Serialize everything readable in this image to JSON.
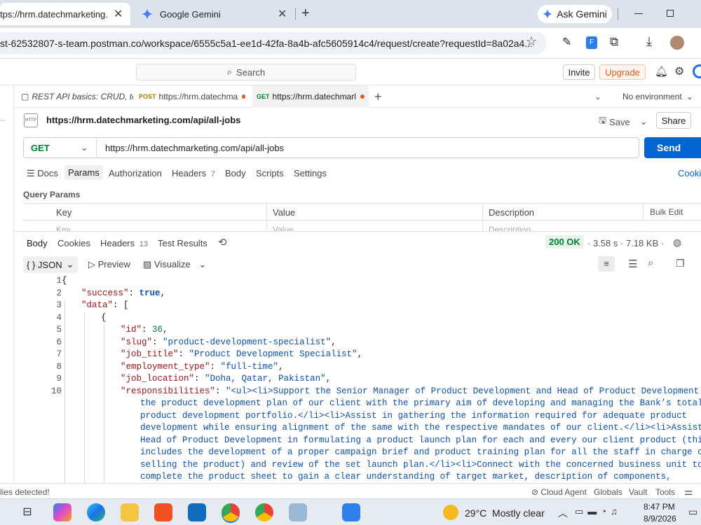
{
  "browser": {
    "tabs": [
      {
        "title": "tps://hrm.datechmarketing.co",
        "active": true
      },
      {
        "title": "Google Gemini",
        "active": false
      }
    ],
    "new_tab": "+",
    "ask_gemini": "Ask Gemini",
    "url": "st-62532807-s-team.postman.co/workspace/6555c5a1-ee1d-42fa-8a4b-afc5605914c4/request/create?requestId=8a02a4..."
  },
  "postman": {
    "search_placeholder": "Search",
    "invite": "Invite",
    "upgrade": "Upgrade",
    "request_tabs": [
      {
        "method": "",
        "label": "REST API basics: CRUD, te"
      },
      {
        "method": "POST",
        "label": "https://hrm.datechma"
      },
      {
        "method": "GET",
        "label": "https://hrm.datechmarl"
      }
    ],
    "environment": "No environment",
    "request_title": "https://hrm.datechmarketing.com/api/all-jobs",
    "save": "Save",
    "share": "Share",
    "method": "GET",
    "request_url": "https://hrm.datechmarketing.com/api/all-jobs",
    "send": "Send",
    "req_nav": {
      "docs": "Docs",
      "params": "Params",
      "authorization": "Authorization",
      "headers": "Headers",
      "headers_count": "7",
      "body": "Body",
      "scripts": "Scripts",
      "settings": "Settings",
      "cookies": "Cooki"
    },
    "query_params": {
      "title": "Query Params",
      "headers": [
        "Key",
        "Value",
        "Description"
      ],
      "bulk_edit": "Bulk Edit",
      "placeholders": [
        "Key",
        "Value",
        "Description"
      ]
    },
    "response": {
      "tabs": {
        "body": "Body",
        "cookies": "Cookies",
        "headers": "Headers",
        "headers_count": "13",
        "test_results": "Test Results"
      },
      "status": "200 OK",
      "time": "3.58 s",
      "size": "7.18 KB",
      "format": "{ } JSON",
      "preview": "Preview",
      "visualize": "Visualize"
    },
    "code_lines": [
      {
        "n": "1",
        "indent": 0,
        "text": "{"
      },
      {
        "n": "2",
        "indent": 1,
        "key": "\"success\"",
        "value": "true",
        "vtype": "bool",
        "trail": ","
      },
      {
        "n": "3",
        "indent": 1,
        "key": "\"data\"",
        "value": "[",
        "vtype": "pun",
        "trail": ""
      },
      {
        "n": "4",
        "indent": 2,
        "text": "{"
      },
      {
        "n": "5",
        "indent": 3,
        "key": "\"id\"",
        "value": "36",
        "vtype": "num",
        "trail": ","
      },
      {
        "n": "6",
        "indent": 3,
        "key": "\"slug\"",
        "value": "\"product-development-specialist\"",
        "vtype": "str",
        "trail": ","
      },
      {
        "n": "7",
        "indent": 3,
        "key": "\"job_title\"",
        "value": "\"Product Development Specialist\"",
        "vtype": "str",
        "trail": ","
      },
      {
        "n": "8",
        "indent": 3,
        "key": "\"employment_type\"",
        "value": "\"full-time\"",
        "vtype": "str",
        "trail": ","
      },
      {
        "n": "9",
        "indent": 3,
        "key": "\"job_location\"",
        "value": "\"Doha, Qatar, Pakistan\"",
        "vtype": "str",
        "trail": ","
      },
      {
        "n": "10",
        "indent": 3,
        "key": "\"responsibilities\"",
        "value": "\"<ul><li>Support the Senior Manager of Product Development and Head of Product Development in",
        "vtype": "str",
        "trail": ""
      }
    ],
    "wrapped_lines": [
      "the product development plan of our client with the primary aim of developing and managing the Bank’s total",
      "product development portfolio.</li><li>Assist in gathering the information required for adequate product",
      "development while ensuring alignment of the same with the respective mandates of our client.</li><li>Assist the",
      "Head of Product Development in formulating a product launch plan for each and every our client product (this",
      "includes the development of a proper campaign brief and product training plan for all the staff in charge of",
      "selling the product) and review of the set launch plan.</li><li>Connect with the concerned business unit to",
      "complete the product sheet to gain a clear understanding of target market, description of components,"
    ],
    "footer": {
      "left": "lies detected!",
      "cloud_agent": "Cloud Agent",
      "globals": "Globals",
      "vault": "Vault",
      "tools": "Tools"
    }
  },
  "taskbar": {
    "weather": "29°C  Mostly clear",
    "time": "8:47 PM",
    "date": "8/9/2026"
  },
  "colors": {
    "send_blue": "#0265d2",
    "upgrade_orange": "#e05a1c",
    "status_green": "#007f31"
  }
}
